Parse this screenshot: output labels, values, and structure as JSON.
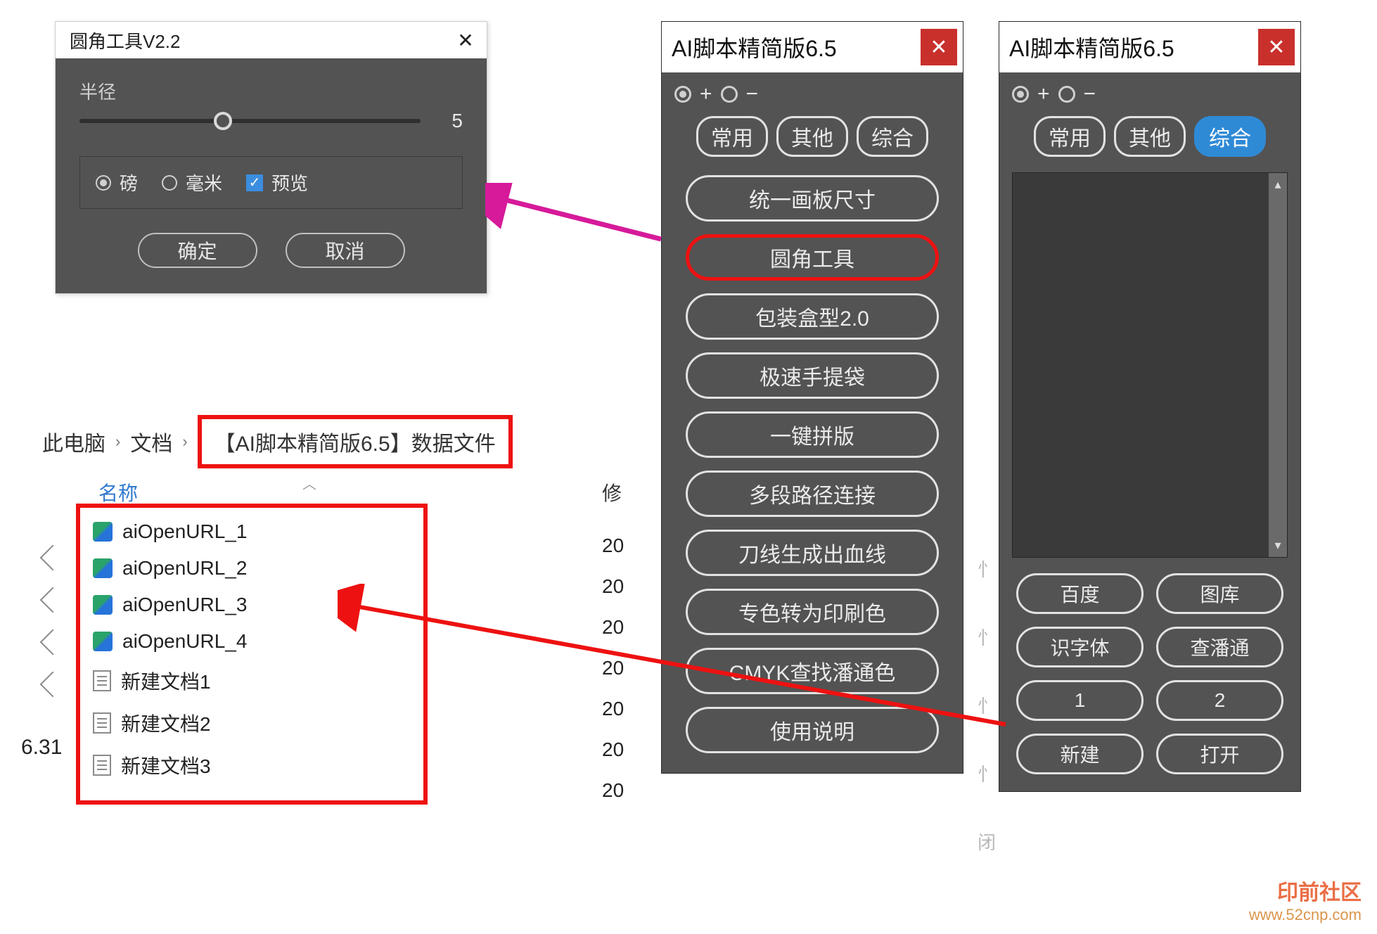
{
  "dialog": {
    "title": "圆角工具V2.2",
    "radius_label": "半径",
    "radius_value": "5",
    "unit_pound": "磅",
    "unit_mm": "毫米",
    "preview": "预览",
    "ok": "确定",
    "cancel": "取消"
  },
  "breadcrumb": {
    "root": "此电脑",
    "docs": "文档",
    "folder": "【AI脚本精简版6.5】数据文件"
  },
  "filelist": {
    "col_name": "名称",
    "col_mod": "修",
    "side_text": "6.31",
    "files": [
      {
        "name": "aiOpenURL_1",
        "kind": "url",
        "mod": "20"
      },
      {
        "name": "aiOpenURL_2",
        "kind": "url",
        "mod": "20"
      },
      {
        "name": "aiOpenURL_3",
        "kind": "url",
        "mod": "20"
      },
      {
        "name": "aiOpenURL_4",
        "kind": "url",
        "mod": "20"
      },
      {
        "name": "新建文档1",
        "kind": "doc",
        "mod": "20"
      },
      {
        "name": "新建文档2",
        "kind": "doc",
        "mod": "20"
      },
      {
        "name": "新建文档3",
        "kind": "doc",
        "mod": "20"
      }
    ]
  },
  "panel_common": {
    "title": "AI脚本精简版6.5",
    "plus": "+",
    "minus": "−",
    "tabs": {
      "t1": "常用",
      "t2": "其他",
      "t3": "综合"
    }
  },
  "panel_left": {
    "tools": [
      "统一画板尺寸",
      "圆角工具",
      "包装盒型2.0",
      "极速手提袋",
      "一键拼版",
      "多段路径连接",
      "刀线生成出血线",
      "专色转为印刷色",
      "CMYK查找潘通色",
      "使用说明"
    ],
    "highlight_index": 1
  },
  "panel_right": {
    "grid": [
      "百度",
      "图库",
      "识字体",
      "查潘通",
      "1",
      "2",
      "新建",
      "打开"
    ]
  },
  "faint": [
    "忄",
    "忄",
    "忄",
    "忄",
    "闭"
  ],
  "watermark": {
    "brand": "印前社区",
    "url": "www.52cnp.com"
  }
}
